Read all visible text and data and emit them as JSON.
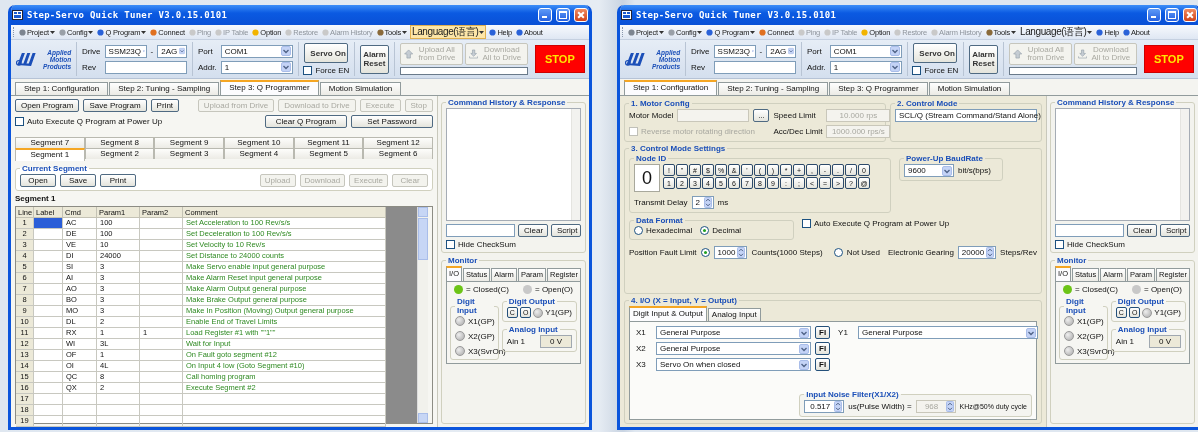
{
  "windows": [
    {
      "title": "Step-Servo Quick Tuner V3.0.15.0101",
      "toolbar": [
        {
          "label": "Project",
          "kind": "icon_button",
          "dropdown": true,
          "disabled": false,
          "selected": false
        },
        {
          "label": "Config",
          "kind": "icon_button",
          "dropdown": true,
          "disabled": false,
          "selected": false
        },
        {
          "label": "Q Program",
          "kind": "icon_button",
          "dropdown": true,
          "disabled": false,
          "selected": false
        },
        {
          "label": "Connect",
          "kind": "icon_button",
          "dropdown": false,
          "disabled": false,
          "selected": false
        },
        {
          "label": "Ping",
          "kind": "icon_button",
          "dropdown": false,
          "disabled": true,
          "selected": false
        },
        {
          "label": "IP Table",
          "kind": "icon_button",
          "dropdown": false,
          "disabled": true,
          "selected": false
        },
        {
          "label": "Option",
          "kind": "icon_button",
          "dropdown": false,
          "disabled": false,
          "selected": false
        },
        {
          "label": "Restore",
          "kind": "icon_button",
          "dropdown": false,
          "disabled": true,
          "selected": false
        },
        {
          "label": "Alarm History",
          "kind": "icon_button",
          "dropdown": false,
          "disabled": true,
          "selected": false
        },
        {
          "label": "Tools",
          "kind": "icon_button",
          "dropdown": true,
          "disabled": false,
          "selected": false
        },
        {
          "label": "Language(语言)",
          "kind": "text_button",
          "dropdown": true,
          "disabled": false,
          "selected": true
        },
        {
          "label": "Help",
          "kind": "icon_button",
          "dropdown": false,
          "disabled": false,
          "selected": false
        },
        {
          "label": "About",
          "kind": "icon_button",
          "dropdown": false,
          "disabled": false,
          "selected": false
        }
      ],
      "header": {
        "logo": "Applied Motion Products",
        "drive": {
          "label": "Drive",
          "model": "SSM23Q",
          "separator": "-",
          "variant": "2AG"
        },
        "rev": {
          "label": "Rev"
        },
        "port": {
          "label": "Port",
          "value": "COM1"
        },
        "addr": {
          "label": "Addr.",
          "value": "1"
        },
        "servo_on": "Servo On",
        "force_en": {
          "label": "Force EN",
          "checked": false
        },
        "alarm_reset": "Alarm Reset",
        "upload_all": {
          "label": "Upload All from Drive",
          "disabled": true
        },
        "download_all": {
          "label": "Download All to Drive",
          "disabled": true
        },
        "transfer_progress": {
          "level": 0
        },
        "stop": "STOP"
      },
      "tabs": [
        {
          "label": "Step 1: Configuration",
          "selected": false
        },
        {
          "label": "Step 2: Tuning - Sampling",
          "selected": false
        },
        {
          "label": "Step 3: Q Programmer",
          "selected": true
        },
        {
          "label": "Motion Simulation",
          "selected": false
        }
      ],
      "content": {
        "kind": "q_programmer",
        "program_buttons": [
          {
            "label": "Open Program",
            "disabled": false
          },
          {
            "label": "Save Program",
            "disabled": false
          },
          {
            "label": "Print",
            "disabled": false
          }
        ],
        "drive_buttons": [
          {
            "label": "Upload from Drive",
            "disabled": true
          },
          {
            "label": "Download to Drive",
            "disabled": true
          },
          {
            "label": "Execute",
            "disabled": true
          },
          {
            "label": "Stop",
            "disabled": true
          }
        ],
        "auto_execute": {
          "label": "Auto Execute Q Program at Power Up",
          "checked": false
        },
        "extra_buttons": [
          {
            "label": "Clear Q Program",
            "disabled": false
          },
          {
            "label": "Set Password",
            "disabled": false
          }
        ],
        "segment_tab_rows": [
          [
            {
              "label": "Segment 7",
              "selected": false
            },
            {
              "label": "Segment 8",
              "selected": false
            },
            {
              "label": "Segment 9",
              "selected": false
            },
            {
              "label": "Segment 10",
              "selected": false
            },
            {
              "label": "Segment 11",
              "selected": false
            },
            {
              "label": "Segment 12",
              "selected": false
            }
          ],
          [
            {
              "label": "Segment 1",
              "selected": true
            },
            {
              "label": "Segment 2",
              "selected": false
            },
            {
              "label": "Segment 3",
              "selected": false
            },
            {
              "label": "Segment 4",
              "selected": false
            },
            {
              "label": "Segment 5",
              "selected": false
            },
            {
              "label": "Segment 6",
              "selected": false
            }
          ]
        ],
        "current_segment": {
          "title": "Current Segment",
          "file_buttons": [
            {
              "label": "Open",
              "disabled": false
            },
            {
              "label": "Save",
              "disabled": false
            },
            {
              "label": "Print",
              "disabled": false
            }
          ],
          "drive_buttons": [
            {
              "label": "Upload",
              "disabled": true
            },
            {
              "label": "Download",
              "disabled": true
            },
            {
              "label": "Execute",
              "disabled": true
            },
            {
              "label": "Clear",
              "disabled": true
            }
          ]
        },
        "segment_title": "Segment 1",
        "table": {
          "columns": [
            "Line",
            "Label",
            "Cmd",
            "Param1",
            "Param2",
            "Comment"
          ],
          "rows": [
            {
              "line": "1",
              "cmd": "AC",
              "param1": "100",
              "comment": "Set Acceleration to 100 Rev/s/s",
              "selected": true
            },
            {
              "line": "2",
              "cmd": "DE",
              "param1": "100",
              "comment": "Set Deceleration to 100 Rev/s/s",
              "selected": false
            },
            {
              "line": "3",
              "cmd": "VE",
              "param1": "10",
              "comment": "Set Velocity to 10 Rev/s",
              "selected": false
            },
            {
              "line": "4",
              "cmd": "DI",
              "param1": "24000",
              "comment": "Set Distance to 24000 counts",
              "selected": false
            },
            {
              "line": "5",
              "cmd": "SI",
              "param1": "3",
              "comment": "Make Servo enable input general purpose",
              "selected": false
            },
            {
              "line": "6",
              "cmd": "AI",
              "param1": "3",
              "comment": "Make Alarm Reset input general purpose",
              "selected": false
            },
            {
              "line": "7",
              "cmd": "AO",
              "param1": "3",
              "comment": "Make Alarm Output general purpose",
              "selected": false
            },
            {
              "line": "8",
              "cmd": "BO",
              "param1": "3",
              "comment": "Make Brake Output general purpose",
              "selected": false
            },
            {
              "line": "9",
              "cmd": "MO",
              "param1": "3",
              "comment": "Make In Position (Moving) Output general purpose",
              "selected": false
            },
            {
              "line": "10",
              "cmd": "DL",
              "param1": "2",
              "comment": "Enable End of Travel Limits",
              "selected": false
            },
            {
              "line": "11",
              "cmd": "RX",
              "param1": "1",
              "param2": "1",
              "comment": "Load Register #1 with \"\"1\"\"",
              "selected": false
            },
            {
              "line": "12",
              "cmd": "WI",
              "param1": "3L",
              "comment": "Wait for Input",
              "selected": false
            },
            {
              "line": "13",
              "cmd": "OF",
              "param1": "1",
              "comment": "On Fault goto segment #12",
              "selected": false
            },
            {
              "line": "14",
              "cmd": "OI",
              "param1": "4L",
              "comment": "On Input 4 low (Goto Segment #10)",
              "selected": false
            },
            {
              "line": "15",
              "cmd": "QC",
              "param1": "8",
              "comment": "Call homing program",
              "selected": false
            },
            {
              "line": "16",
              "cmd": "QX",
              "param1": "2",
              "comment": "Execute Segment #2",
              "selected": false
            },
            {
              "line": "17",
              "selected": false
            },
            {
              "line": "18",
              "selected": false
            },
            {
              "line": "19",
              "selected": false
            }
          ]
        }
      },
      "side": {
        "history": {
          "title": "Command History & Response",
          "buttons": [
            "Clear",
            "Script"
          ],
          "hide_checksum": {
            "label": "Hide CheckSum",
            "checked": false
          }
        },
        "monitor": {
          "title": "Monitor",
          "tabs": [
            {
              "label": "I/O",
              "selected": true
            },
            {
              "label": "Status",
              "selected": false
            },
            {
              "label": "Alarm",
              "selected": false
            },
            {
              "label": "Param",
              "selected": false
            },
            {
              "label": "Register",
              "selected": false
            }
          ],
          "legend": [
            {
              "label": "= Closed(C)",
              "color": "#6cc417"
            },
            {
              "label": "= Open(O)",
              "color": "#c8c8c8"
            }
          ],
          "digit_input": {
            "title": "Digit Input",
            "items": [
              {
                "label": "X1(GP)",
                "on": false
              },
              {
                "label": "X2(GP)",
                "on": false
              },
              {
                "label": "X3(SvrOn)",
                "on": false
              }
            ]
          },
          "digit_output": {
            "title": "Digit Output",
            "buttons": [
              "C",
              "O"
            ],
            "items": [
              {
                "label": "Y1(GP)",
                "on": false
              }
            ]
          },
          "analog_input": {
            "title": "Analog Input",
            "label": "Ain 1",
            "value": "0 V"
          }
        }
      }
    },
    {
      "title": "Step-Servo Quick Tuner V3.0.15.0101",
      "toolbar": [
        {
          "label": "Project",
          "kind": "icon_button",
          "dropdown": true,
          "disabled": false,
          "selected": false
        },
        {
          "label": "Config",
          "kind": "icon_button",
          "dropdown": true,
          "disabled": false,
          "selected": false
        },
        {
          "label": "Q Program",
          "kind": "icon_button",
          "dropdown": true,
          "disabled": false,
          "selected": false
        },
        {
          "label": "Connect",
          "kind": "icon_button",
          "dropdown": false,
          "disabled": false,
          "selected": false
        },
        {
          "label": "Ping",
          "kind": "icon_button",
          "dropdown": false,
          "disabled": true,
          "selected": false
        },
        {
          "label": "IP Table",
          "kind": "icon_button",
          "dropdown": false,
          "disabled": true,
          "selected": false
        },
        {
          "label": "Option",
          "kind": "icon_button",
          "dropdown": false,
          "disabled": false,
          "selected": false
        },
        {
          "label": "Restore",
          "kind": "icon_button",
          "dropdown": false,
          "disabled": true,
          "selected": false
        },
        {
          "label": "Alarm History",
          "kind": "icon_button",
          "dropdown": false,
          "disabled": true,
          "selected": false
        },
        {
          "label": "Tools",
          "kind": "icon_button",
          "dropdown": true,
          "disabled": false,
          "selected": false
        },
        {
          "label": "Language(语言)",
          "kind": "text_button",
          "dropdown": true,
          "disabled": false,
          "selected": false
        },
        {
          "label": "Help",
          "kind": "icon_button",
          "dropdown": false,
          "disabled": false,
          "selected": false
        },
        {
          "label": "About",
          "kind": "icon_button",
          "dropdown": false,
          "disabled": false,
          "selected": false
        }
      ],
      "header": {
        "logo": "Applied Motion Products",
        "drive": {
          "label": "Drive",
          "model": "SSM23Q",
          "separator": "-",
          "variant": "2AG"
        },
        "rev": {
          "label": "Rev"
        },
        "port": {
          "label": "Port",
          "value": "COM1"
        },
        "addr": {
          "label": "Addr.",
          "value": "1"
        },
        "servo_on": "Servo On",
        "force_en": {
          "label": "Force EN",
          "checked": false
        },
        "alarm_reset": "Alarm Reset",
        "upload_all": {
          "label": "Upload All from Drive",
          "disabled": true
        },
        "download_all": {
          "label": "Download All to Drive",
          "disabled": true
        },
        "transfer_progress": {
          "level": 0
        },
        "stop": "STOP"
      },
      "tabs": [
        {
          "label": "Step 1: Configuration",
          "selected": true
        },
        {
          "label": "Step 2: Tuning - Sampling",
          "selected": false
        },
        {
          "label": "Step 3: Q Programmer",
          "selected": false
        },
        {
          "label": "Motion Simulation",
          "selected": false
        }
      ],
      "content": {
        "kind": "configuration",
        "motor_config": {
          "title": "1. Motor Config",
          "motor_model_label": "Motor Model",
          "browse": "...",
          "speed_limit": {
            "label": "Speed Limit",
            "value": "10.000 rps"
          },
          "acc_limit": {
            "label": "Acc/Dec Limit",
            "value": "1000.000 rps/s"
          },
          "reverse": {
            "label": "Reverse motor rotating direction",
            "checked": false,
            "disabled": true
          }
        },
        "control_mode": {
          "title": "2. Control Mode",
          "value": "SCL/Q (Stream Command/Stand Alone)"
        },
        "settings": {
          "title": "3. Control Mode Settings",
          "node_id": {
            "title": "Node ID",
            "value": "0",
            "keys": [
              "!",
              "\"",
              "#",
              "$",
              "%",
              "&",
              "'",
              "(",
              ")",
              "*",
              "+",
              ",",
              "-",
              ".",
              "/",
              "0",
              "1",
              "2",
              "3",
              "4",
              "5",
              "6",
              "7",
              "8",
              "9",
              ":",
              ";",
              "<",
              "=",
              ">",
              "?",
              "@"
            ]
          },
          "transmit_delay": {
            "label": "Transmit Delay",
            "value": "2",
            "unit": "ms"
          },
          "baud_rate": {
            "title": "Power-Up BaudRate",
            "value": "9600",
            "unit": "bit/s(bps)"
          },
          "data_format": {
            "title": "Data Format",
            "options": [
              {
                "label": "Hexadecimal",
                "selected": false
              },
              {
                "label": "Decimal",
                "selected": true
              }
            ]
          },
          "auto_execute": {
            "label": "Auto Execute Q Program at Power Up",
            "checked": false
          },
          "position_fault": {
            "options": [
              {
                "label": "Position Fault Limit",
                "selected": true
              },
              {
                "label": "Not Used",
                "selected": false
              }
            ],
            "value": "1000",
            "unit": "Counts(1000 Steps)"
          },
          "gearing": {
            "label": "Electronic Gearing",
            "value": "20000",
            "unit": "Steps/Rev"
          }
        },
        "io": {
          "title": "4. I/O (X = Input, Y = Output)",
          "tabs": [
            {
              "label": "Digit Input & Output",
              "selected": true
            },
            {
              "label": "Analog Input",
              "selected": false
            }
          ],
          "inputs": [
            {
              "label": "X1",
              "value": "General Purpose",
              "button": "FI"
            },
            {
              "label": "X2",
              "value": "General Purpose",
              "button": "FI"
            },
            {
              "label": "X3",
              "value": "Servo On when closed",
              "button": "FI"
            }
          ],
          "outputs": [
            {
              "label": "Y1",
              "value": "General Purpose"
            }
          ],
          "noise_filter": {
            "title": "Input Noise Filter(X1/X2)",
            "value": "0.517",
            "unit": "us(Pulse Width) =",
            "frequency": {
              "value": "968",
              "disabled": true
            },
            "frequency_unit": "KHz@50% duty cycle"
          }
        }
      },
      "side": {
        "history": {
          "title": "Command History & Response",
          "buttons": [
            "Clear",
            "Script"
          ],
          "hide_checksum": {
            "label": "Hide CheckSum",
            "checked": false
          }
        },
        "monitor": {
          "title": "Monitor",
          "tabs": [
            {
              "label": "I/O",
              "selected": true
            },
            {
              "label": "Status",
              "selected": false
            },
            {
              "label": "Alarm",
              "selected": false
            },
            {
              "label": "Param",
              "selected": false
            },
            {
              "label": "Register",
              "selected": false
            }
          ],
          "legend": [
            {
              "label": "= Closed(C)",
              "color": "#6cc417"
            },
            {
              "label": "= Open(O)",
              "color": "#c8c8c8"
            }
          ],
          "digit_input": {
            "title": "Digit Input",
            "items": [
              {
                "label": "X1(GP)",
                "on": false
              },
              {
                "label": "X2(GP)",
                "on": false
              },
              {
                "label": "X3(SvrOn)",
                "on": false
              }
            ]
          },
          "digit_output": {
            "title": "Digit Output",
            "buttons": [
              "C",
              "O"
            ],
            "items": [
              {
                "label": "Y1(GP)",
                "on": false
              }
            ]
          },
          "analog_input": {
            "title": "Analog Input",
            "label": "Ain 1",
            "value": "0 V"
          }
        }
      }
    }
  ]
}
